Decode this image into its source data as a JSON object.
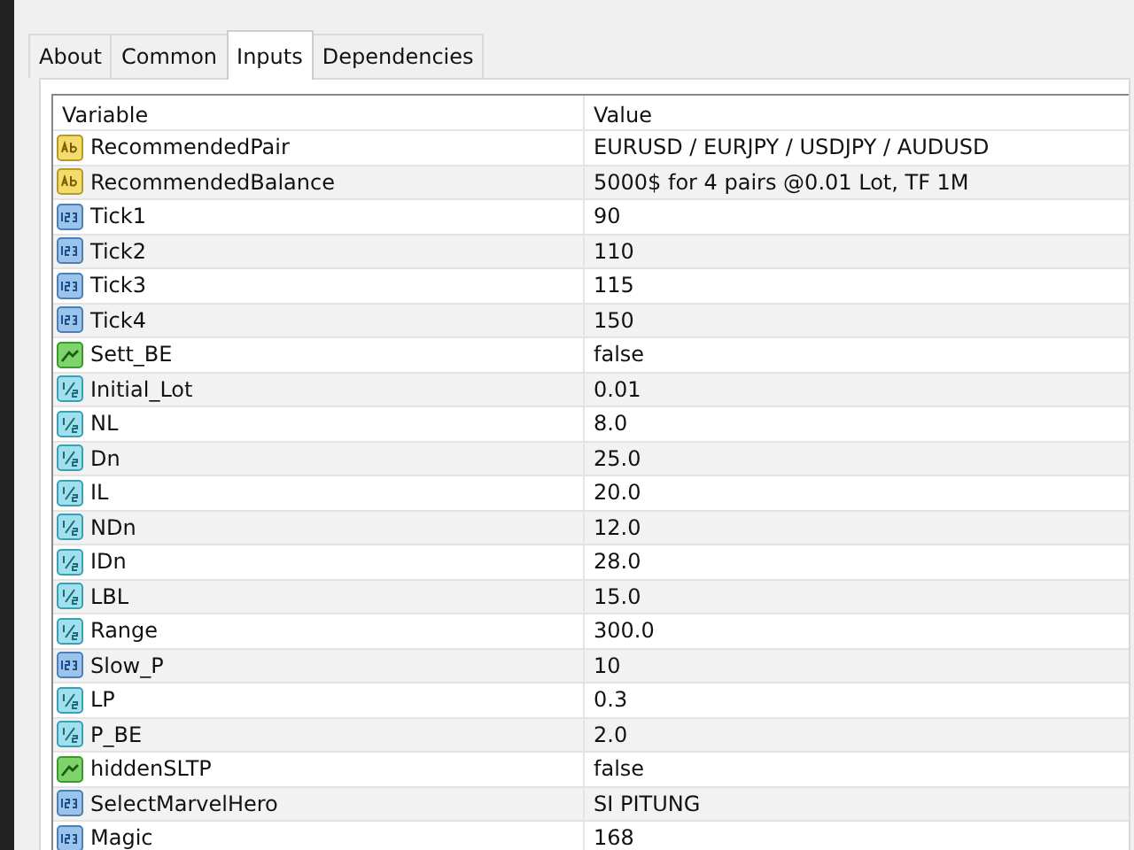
{
  "tabs": [
    {
      "label": "About",
      "selected": false
    },
    {
      "label": "Common",
      "selected": false
    },
    {
      "label": "Inputs",
      "selected": true
    },
    {
      "label": "Dependencies",
      "selected": false
    }
  ],
  "table": {
    "columns": [
      "Variable",
      "Value"
    ],
    "rows": [
      {
        "kind": "string",
        "variable": "RecommendedPair",
        "value": "EURUSD / EURJPY / USDJPY / AUDUSD"
      },
      {
        "kind": "string",
        "variable": "RecommendedBalance",
        "value": "5000$ for 4 pairs @0.01 Lot, TF 1M"
      },
      {
        "kind": "int",
        "variable": "Tick1",
        "value": "90"
      },
      {
        "kind": "int",
        "variable": "Tick2",
        "value": "110"
      },
      {
        "kind": "int",
        "variable": "Tick3",
        "value": "115"
      },
      {
        "kind": "int",
        "variable": "Tick4",
        "value": "150"
      },
      {
        "kind": "bool",
        "variable": "Sett_BE",
        "value": "false"
      },
      {
        "kind": "double",
        "variable": "Initial_Lot",
        "value": "0.01"
      },
      {
        "kind": "double",
        "variable": "NL",
        "value": "8.0"
      },
      {
        "kind": "double",
        "variable": "Dn",
        "value": "25.0"
      },
      {
        "kind": "double",
        "variable": "IL",
        "value": "20.0"
      },
      {
        "kind": "double",
        "variable": "NDn",
        "value": "12.0"
      },
      {
        "kind": "double",
        "variable": "IDn",
        "value": "28.0"
      },
      {
        "kind": "double",
        "variable": "LBL",
        "value": "15.0"
      },
      {
        "kind": "double",
        "variable": "Range",
        "value": "300.0"
      },
      {
        "kind": "int",
        "variable": "Slow_P",
        "value": "10"
      },
      {
        "kind": "double",
        "variable": "LP",
        "value": "0.3"
      },
      {
        "kind": "double",
        "variable": "P_BE",
        "value": "2.0"
      },
      {
        "kind": "bool",
        "variable": "hiddenSLTP",
        "value": "false"
      },
      {
        "kind": "int",
        "variable": "SelectMarvelHero",
        "value": "SI PITUNG"
      },
      {
        "kind": "int",
        "variable": "Magic",
        "value": "168"
      }
    ]
  }
}
